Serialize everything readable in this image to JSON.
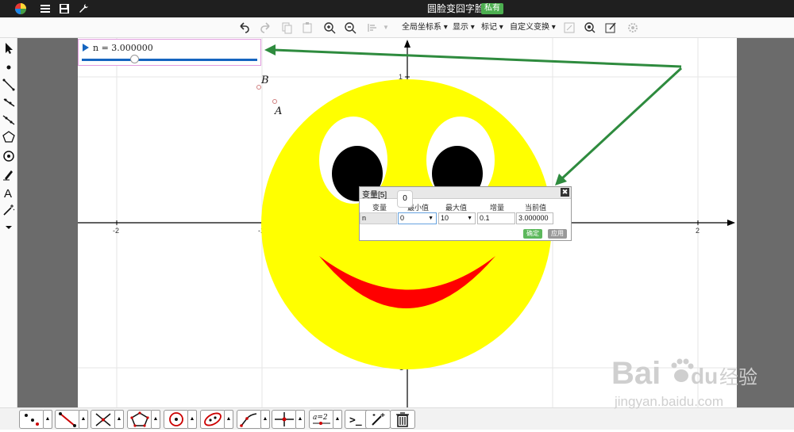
{
  "window": {
    "title": "圆脸变囧字脸",
    "badge": "私有"
  },
  "toolbar": {
    "menus": [
      "全局坐标系",
      "显示",
      "标记",
      "自定义变换"
    ]
  },
  "slider": {
    "label": "n = 3.000000",
    "value": 3.0,
    "min": 0,
    "max": 10,
    "fraction": 0.3
  },
  "canvas": {
    "points": [
      {
        "name": "B"
      },
      {
        "name": "A"
      }
    ],
    "tick_labels": {
      "x_neg2": "-2",
      "x_neg1": "-1",
      "x_pos2": "2",
      "y_pos1": "1",
      "y_neg1": "-1"
    },
    "colors": {
      "face": "#ffff00",
      "eye_white": "#ffffff",
      "pupil": "#000000",
      "mouth": "#ff0000",
      "arrow": "#2e8b3e"
    }
  },
  "dialog": {
    "title": "变量[5]",
    "columns": [
      "变量",
      "最小值",
      "最大值",
      "增量",
      "当前值"
    ],
    "row": {
      "name": "n",
      "min": "0",
      "max": "10",
      "step": "0.1",
      "current": "3.000000"
    },
    "ok_label": "确定",
    "apply_label": "应用",
    "tooltip": "0"
  },
  "watermark": {
    "brand": "Bai",
    "suffix": "du",
    "cn": "经验",
    "url": "jingyan.baidu.com"
  }
}
